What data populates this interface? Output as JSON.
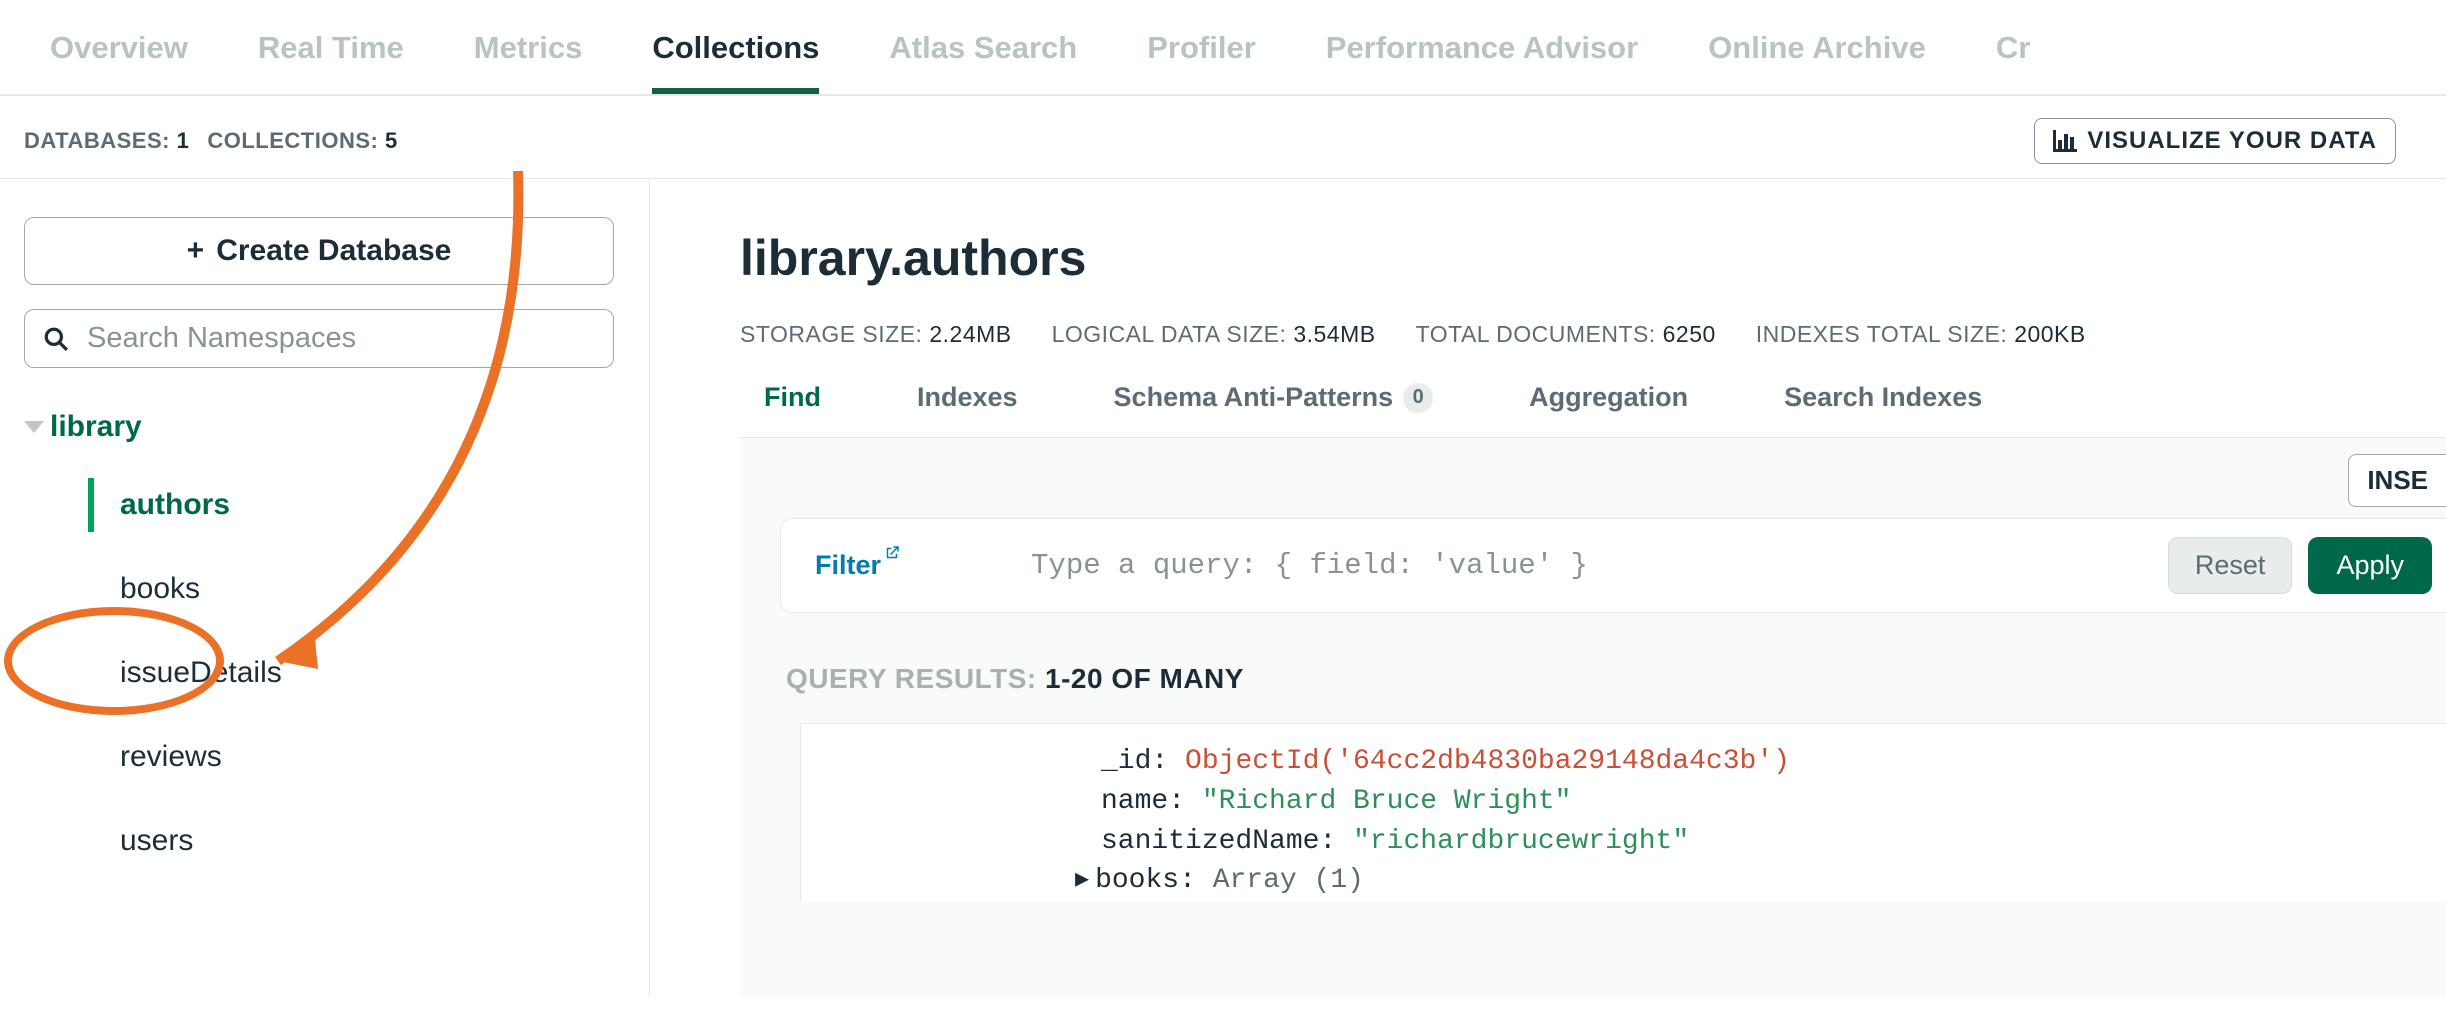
{
  "tabs": [
    "Overview",
    "Real Time",
    "Metrics",
    "Collections",
    "Atlas Search",
    "Profiler",
    "Performance Advisor",
    "Online Archive",
    "Cr"
  ],
  "activeTab": "Collections",
  "infobar": {
    "db_label": "DATABASES:",
    "db_count": "1",
    "coll_label": "COLLECTIONS:",
    "coll_count": "5",
    "visualize": "VISUALIZE YOUR DATA"
  },
  "sidebar": {
    "create_db": "Create Database",
    "search_placeholder": "Search Namespaces",
    "db_name": "library",
    "collections": [
      "authors",
      "books",
      "issueDetails",
      "reviews",
      "users"
    ],
    "active_collection": "authors"
  },
  "main": {
    "title": "library.authors",
    "stats": [
      {
        "label": "STORAGE SIZE:",
        "val": "2.24MB"
      },
      {
        "label": "LOGICAL DATA SIZE:",
        "val": "3.54MB"
      },
      {
        "label": "TOTAL DOCUMENTS:",
        "val": "6250"
      },
      {
        "label": "INDEXES TOTAL SIZE:",
        "val": "200KB"
      }
    ],
    "subtabs": {
      "find": "Find",
      "indexes": "Indexes",
      "anti": "Schema Anti-Patterns",
      "anti_badge": "0",
      "agg": "Aggregation",
      "search": "Search Indexes"
    },
    "insert_label": "INSE",
    "filter": {
      "label": "Filter",
      "placeholder": "Type a query: { field: 'value' }",
      "reset": "Reset",
      "apply": "Apply"
    },
    "results_label": "QUERY RESULTS:",
    "results_range": "1-20 OF MANY",
    "doc": {
      "id_key": "_id:",
      "id_val": "ObjectId('64cc2db4830ba29148da4c3b')",
      "name_key": "name:",
      "name_val": "\"Richard Bruce Wright\"",
      "san_key": "sanitizedName:",
      "san_val": "\"richardbrucewright\"",
      "books_key": "books:",
      "books_val": "Array (1)"
    }
  }
}
